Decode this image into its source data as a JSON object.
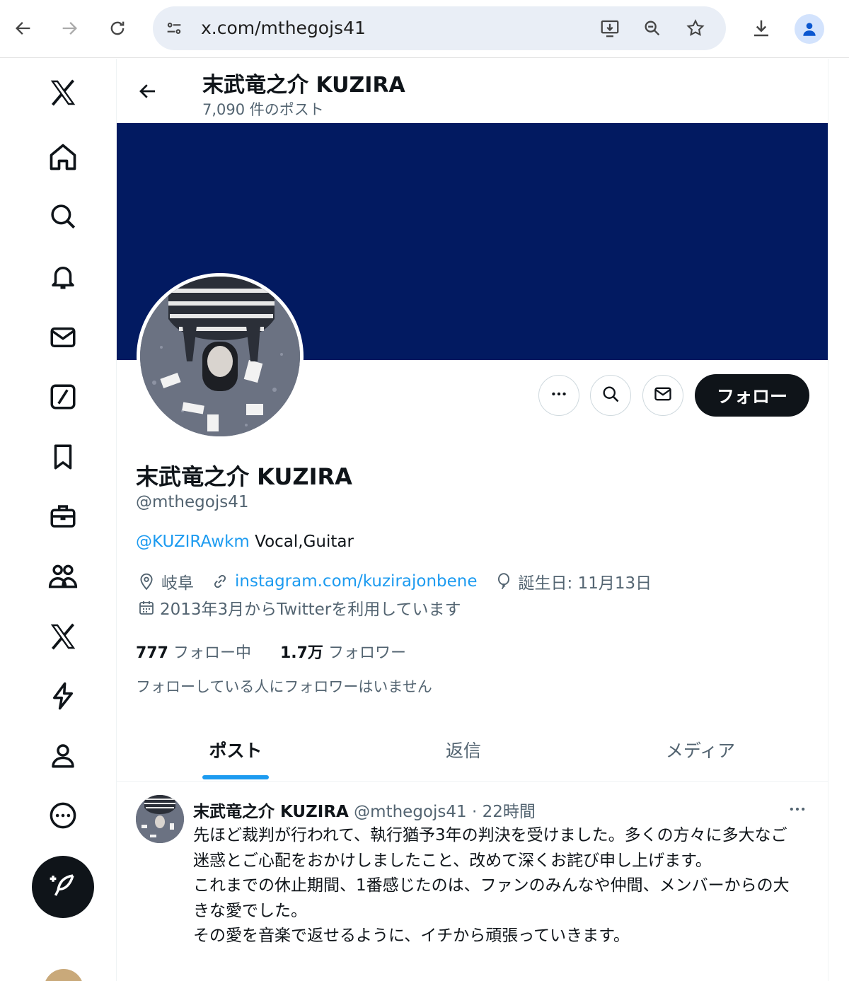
{
  "browser": {
    "url": "x.com/mthegojs41",
    "icons": [
      "back-arrow-icon",
      "forward-arrow-icon",
      "reload-icon",
      "site-settings-icon",
      "install-app-icon",
      "zoom-icon",
      "bookmark-star-icon",
      "download-icon",
      "profile-icon"
    ]
  },
  "sidebar": {
    "items": [
      "x-logo-icon",
      "home-icon",
      "explore-icon",
      "notifications-icon",
      "messages-icon",
      "grok-icon",
      "bookmarks-icon",
      "jobs-icon",
      "communities-icon",
      "premium-x-icon",
      "verified-orgs-icon",
      "profile-icon",
      "more-icon"
    ],
    "post_button_icon": "compose-feather-icon"
  },
  "header": {
    "name": "末武竜之介 KUZIRA",
    "post_count": "7,090 件のポスト"
  },
  "colors": {
    "banner": "#021a61",
    "accent": "#1d9bf0",
    "follow_button": "#0f1419"
  },
  "profile": {
    "name": "末武竜之介 KUZIRA",
    "handle": "@mthegojs41",
    "bio_mention": "@KUZIRAwkm",
    "bio_text": " Vocal,Guitar",
    "location": "岐阜",
    "website": "instagram.com/kuzirajonbene",
    "birthday": "誕生日: 11月13日",
    "joined": "2013年3月からTwitterを利用しています",
    "following_count": "777",
    "following_label": "フォロー中",
    "followers_count": "1.7万",
    "followers_label": "フォロワー",
    "mutuals": "フォローしている人にフォロワーはいません",
    "follow_button": "フォロー"
  },
  "tabs": [
    {
      "label": "ポスト",
      "active": true
    },
    {
      "label": "返信",
      "active": false
    },
    {
      "label": "メディア",
      "active": false
    }
  ],
  "tweet": {
    "name": "末武竜之介 KUZIRA",
    "meta": " @mthegojs41 · 22時間",
    "lines": [
      "先ほど裁判が行われて、執行猶予3年の判決を受けました。多くの方々に多大なご迷惑とご心配をおかけしましたこと、改めて深くお詫び申し上げます。",
      "これまでの休止期間、1番感じたのは、ファンのみんなや仲間、メンバーからの大きな愛でした。",
      "その愛を音楽で返せるように、イチから頑張っていきます。"
    ]
  }
}
